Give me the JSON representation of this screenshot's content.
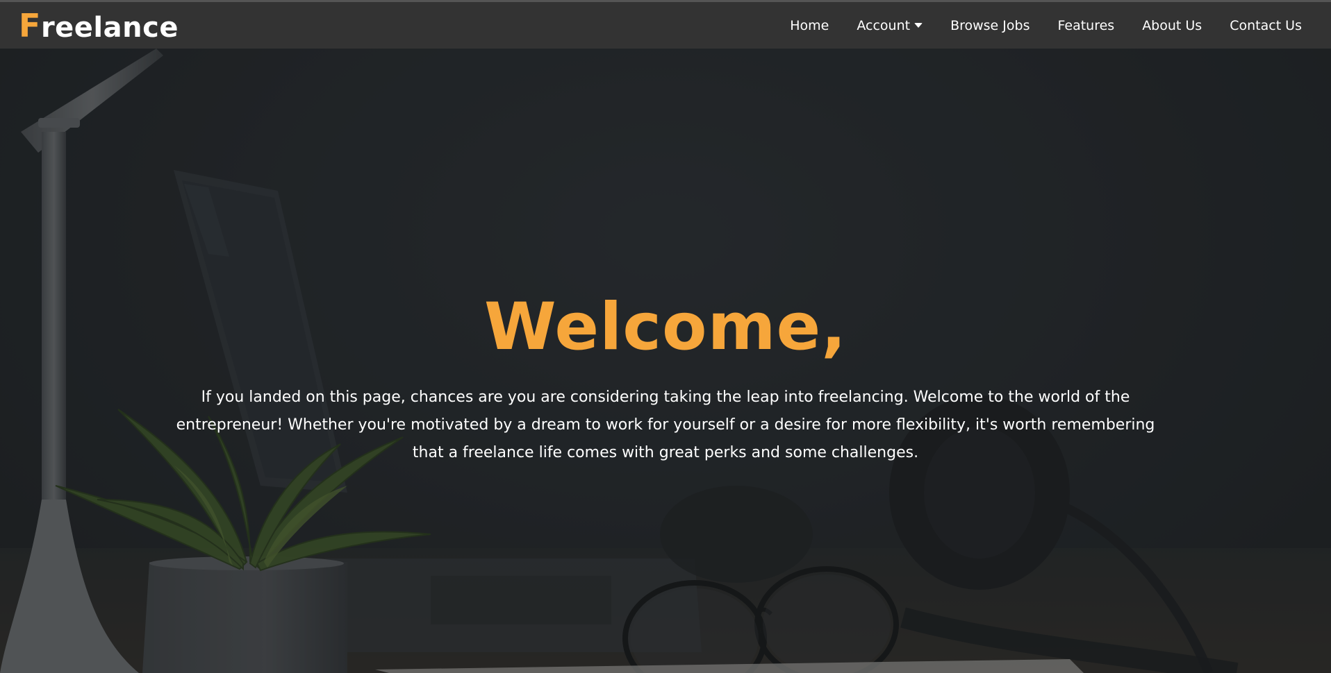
{
  "brand": {
    "first_letter": "F",
    "rest": "reelance",
    "accent_color": "#f6a63b"
  },
  "nav": {
    "items": [
      {
        "label": "Home"
      },
      {
        "label": "Account",
        "icon": "caret-down-icon"
      },
      {
        "label": "Browse Jobs"
      },
      {
        "label": "Features"
      },
      {
        "label": "About Us"
      },
      {
        "label": "Contact Us"
      }
    ]
  },
  "hero": {
    "title": "Welcome,",
    "text": "If you landed on this page, chances are you are considering taking the leap into freelancing. Welcome to the world of the entrepreneur! Whether you're motivated by a dream to work for yourself or a desire for more flexibility, it's worth remembering that a freelance life comes with great perks and some challenges.",
    "background_image": "desk-scene-with-lamp-laptop-plant-glasses-headphones"
  },
  "colors": {
    "navbar_bg": "#333333",
    "hero_overlay": "#26292d",
    "text": "#ffffff"
  }
}
